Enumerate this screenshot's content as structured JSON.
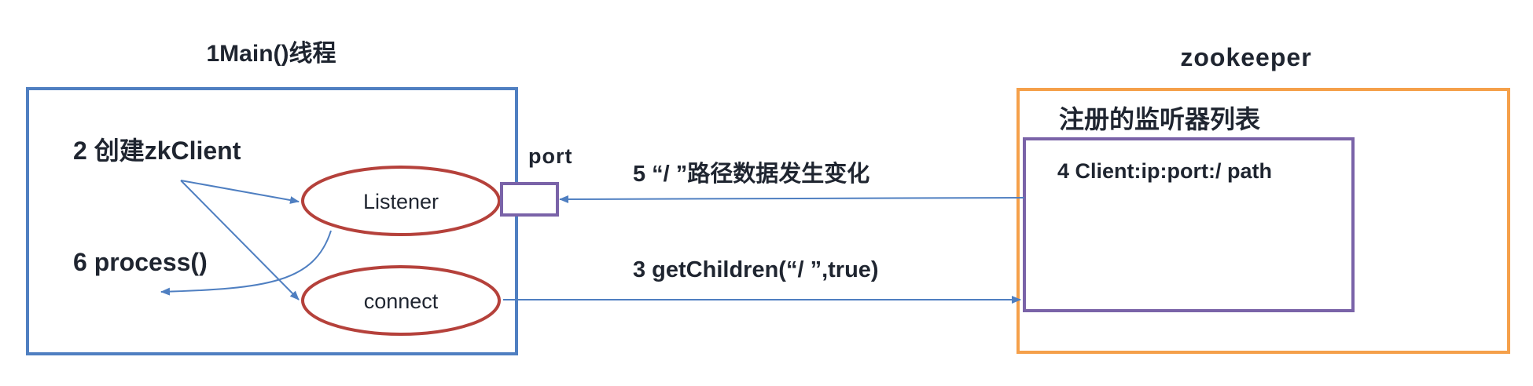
{
  "main_thread": {
    "title": "1Main()线程",
    "create_client": "2 创建zkClient",
    "process": "6 process()",
    "listener": "Listener",
    "connect": "connect",
    "port": "port"
  },
  "zookeeper": {
    "title": "zookeeper",
    "registry_title": "注册的监听器列表",
    "registry_entry": "4 Client:ip:port:/ path"
  },
  "edges": {
    "data_changed": "5 “/ ”路径数据发生变化",
    "get_children": "3 getChildren(“/ ”,true)"
  },
  "colors": {
    "main_border": "#4f7fc1",
    "zk_border": "#f5a04a",
    "registry_border": "#7a63a8",
    "ellipse_border": "#b5413b",
    "arrow": "#4f7fc1"
  }
}
